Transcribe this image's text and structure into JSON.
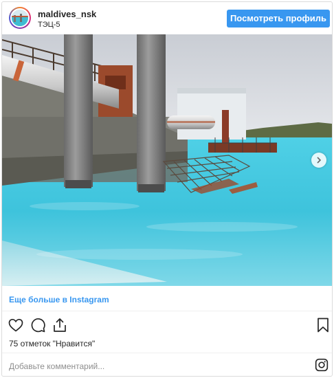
{
  "header": {
    "username": "maldives_nsk",
    "location": "ТЭЦ-5",
    "profile_button": "Посмотреть профиль"
  },
  "more_link": "Еще больше в Instagram",
  "likes_text": "75 отметок \"Нравится\"",
  "comment_placeholder": "Добавьте комментарий...",
  "colors": {
    "accent": "#3897f0",
    "text": "#262626",
    "muted": "#8e8e8e"
  },
  "icons": [
    "heart-icon",
    "comment-icon",
    "share-icon",
    "bookmark-icon",
    "instagram-icon",
    "chevron-right-icon"
  ]
}
